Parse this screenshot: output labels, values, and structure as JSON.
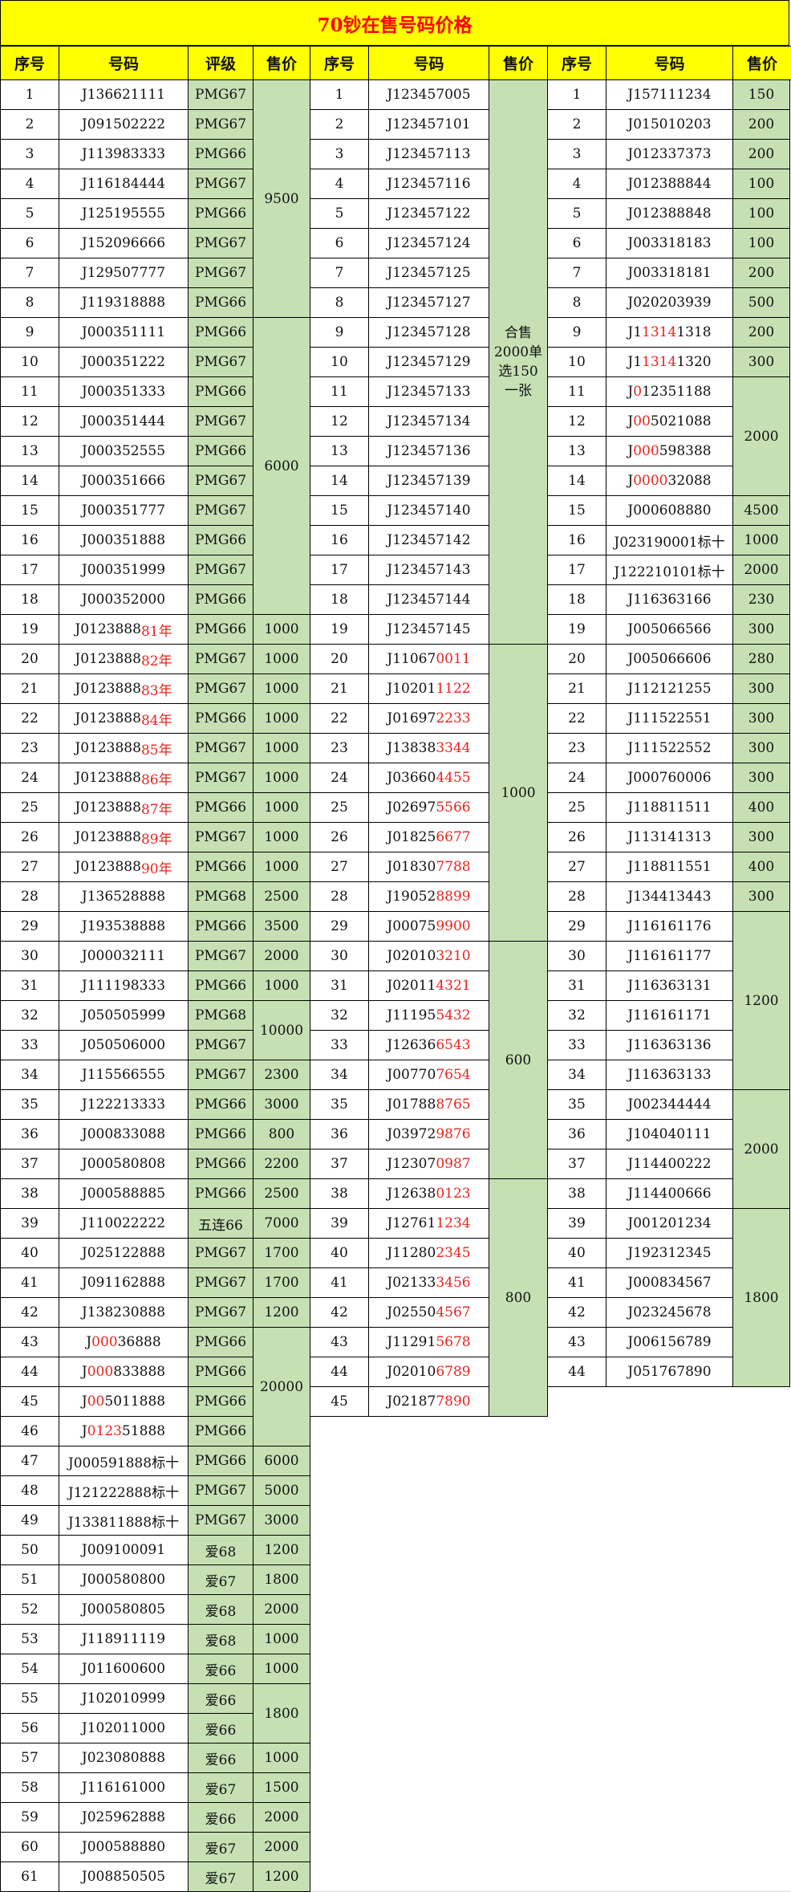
{
  "title": "70钞在售号码价格",
  "colors": {
    "header_bg": "#ffff00",
    "title_text": "#ff0000",
    "green": "#c6e0b4",
    "highlight": "#e8241d"
  },
  "headers": {
    "left": [
      "序号",
      "号码",
      "评级",
      "售价"
    ],
    "middle": [
      "序号",
      "号码",
      "售价"
    ],
    "right": [
      "序号",
      "号码",
      "售价"
    ]
  },
  "left_rows": [
    {
      "n": "1",
      "c": "J136621111",
      "g": "PMG67"
    },
    {
      "n": "2",
      "c": "J091502222",
      "g": "PMG67"
    },
    {
      "n": "3",
      "c": "J113983333",
      "g": "PMG66"
    },
    {
      "n": "4",
      "c": "J116184444",
      "g": "PMG67"
    },
    {
      "n": "5",
      "c": "J125195555",
      "g": "PMG66"
    },
    {
      "n": "6",
      "c": "J152096666",
      "g": "PMG67"
    },
    {
      "n": "7",
      "c": "J129507777",
      "g": "PMG67"
    },
    {
      "n": "8",
      "c": "J119318888",
      "g": "PMG66"
    },
    {
      "n": "9",
      "c": "J000351111",
      "g": "PMG66"
    },
    {
      "n": "10",
      "c": "J000351222",
      "g": "PMG67"
    },
    {
      "n": "11",
      "c": "J000351333",
      "g": "PMG66"
    },
    {
      "n": "12",
      "c": "J000351444",
      "g": "PMG67"
    },
    {
      "n": "13",
      "c": "J000352555",
      "g": "PMG66"
    },
    {
      "n": "14",
      "c": "J000351666",
      "g": "PMG67"
    },
    {
      "n": "15",
      "c": "J000351777",
      "g": "PMG67"
    },
    {
      "n": "16",
      "c": "J000351888",
      "g": "PMG66"
    },
    {
      "n": "17",
      "c": "J000351999",
      "g": "PMG67"
    },
    {
      "n": "18",
      "c": "J000352000",
      "g": "PMG66"
    },
    {
      "n": "19",
      "c": "J0123888",
      "r": "81年",
      "g": "PMG66"
    },
    {
      "n": "20",
      "c": "J0123888",
      "r": "82年",
      "g": "PMG67"
    },
    {
      "n": "21",
      "c": "J0123888",
      "r": "83年",
      "g": "PMG67"
    },
    {
      "n": "22",
      "c": "J0123888",
      "r": "84年",
      "g": "PMG66"
    },
    {
      "n": "23",
      "c": "J0123888",
      "r": "85年",
      "g": "PMG67"
    },
    {
      "n": "24",
      "c": "J0123888",
      "r": "86年",
      "g": "PMG67"
    },
    {
      "n": "25",
      "c": "J0123888",
      "r": "87年",
      "g": "PMG66"
    },
    {
      "n": "26",
      "c": "J0123888",
      "r": "89年",
      "g": "PMG67"
    },
    {
      "n": "27",
      "c": "J0123888",
      "r": "90年",
      "g": "PMG66"
    },
    {
      "n": "28",
      "c": "J136528888",
      "g": "PMG68"
    },
    {
      "n": "29",
      "c": "J193538888",
      "g": "PMG66"
    },
    {
      "n": "30",
      "c": "J000032111",
      "g": "PMG67"
    },
    {
      "n": "31",
      "c": "J111198333",
      "g": "PMG66"
    },
    {
      "n": "32",
      "c": "J050505999",
      "g": "PMG68"
    },
    {
      "n": "33",
      "c": "J050506000",
      "g": "PMG67"
    },
    {
      "n": "34",
      "c": "J115566555",
      "g": "PMG67"
    },
    {
      "n": "35",
      "c": "J122213333",
      "g": "PMG66"
    },
    {
      "n": "36",
      "c": "J000833088",
      "g": "PMG66"
    },
    {
      "n": "37",
      "c": "J000580808",
      "g": "PMG66"
    },
    {
      "n": "38",
      "c": "J000588885",
      "g": "PMG66"
    },
    {
      "n": "39",
      "c": "J110022222",
      "g": "五连66"
    },
    {
      "n": "40",
      "c": "J025122888",
      "g": "PMG67"
    },
    {
      "n": "41",
      "c": "J091162888",
      "g": "PMG67"
    },
    {
      "n": "42",
      "c": "J138230888",
      "g": "PMG67"
    },
    {
      "n": "43",
      "c": "J",
      "r": "000",
      "c2": "36888",
      "g": "PMG66"
    },
    {
      "n": "44",
      "c": "J",
      "r": "000",
      "c2": "833888",
      "g": "PMG66"
    },
    {
      "n": "45",
      "c": "J",
      "r": "00",
      "c2": "5011888",
      "g": "PMG66"
    },
    {
      "n": "46",
      "c": "J",
      "r": "0123",
      "c2": "51888",
      "g": "PMG66"
    },
    {
      "n": "47",
      "c": "J000591888标十",
      "g": "PMG66"
    },
    {
      "n": "48",
      "c": "J121222888标十",
      "g": "PMG67"
    },
    {
      "n": "49",
      "c": "J133811888标十",
      "g": "PMG67"
    },
    {
      "n": "50",
      "c": "J009100091",
      "g": "爱68"
    },
    {
      "n": "51",
      "c": "J000580800",
      "g": "爱67"
    },
    {
      "n": "52",
      "c": "J000580805",
      "g": "爱68"
    },
    {
      "n": "53",
      "c": "J118911119",
      "g": "爱68"
    },
    {
      "n": "54",
      "c": "J011600600",
      "g": "爱66"
    },
    {
      "n": "55",
      "c": "J102010999",
      "g": "爱66"
    },
    {
      "n": "56",
      "c": "J102011000",
      "g": "爱66"
    },
    {
      "n": "57",
      "c": "J023080888",
      "g": "爱66"
    },
    {
      "n": "58",
      "c": "J116161000",
      "g": "爱67"
    },
    {
      "n": "59",
      "c": "J025962888",
      "g": "爱66"
    },
    {
      "n": "60",
      "c": "J000588880",
      "g": "爱67"
    },
    {
      "n": "61",
      "c": "J008850505",
      "g": "爱67"
    }
  ],
  "left_prices": [
    {
      "start": 0,
      "span": 8,
      "v": "9500"
    },
    {
      "start": 8,
      "span": 10,
      "v": "6000"
    },
    {
      "start": 18,
      "span": 1,
      "v": "1000"
    },
    {
      "start": 19,
      "span": 1,
      "v": "1000"
    },
    {
      "start": 20,
      "span": 1,
      "v": "1000"
    },
    {
      "start": 21,
      "span": 1,
      "v": "1000"
    },
    {
      "start": 22,
      "span": 1,
      "v": "1000"
    },
    {
      "start": 23,
      "span": 1,
      "v": "1000"
    },
    {
      "start": 24,
      "span": 1,
      "v": "1000"
    },
    {
      "start": 25,
      "span": 1,
      "v": "1000"
    },
    {
      "start": 26,
      "span": 1,
      "v": "1000"
    },
    {
      "start": 27,
      "span": 1,
      "v": "2500"
    },
    {
      "start": 28,
      "span": 1,
      "v": "3500"
    },
    {
      "start": 29,
      "span": 1,
      "v": "2000"
    },
    {
      "start": 30,
      "span": 1,
      "v": "1000"
    },
    {
      "start": 31,
      "span": 2,
      "v": "10000"
    },
    {
      "start": 33,
      "span": 1,
      "v": "2300"
    },
    {
      "start": 34,
      "span": 1,
      "v": "3000"
    },
    {
      "start": 35,
      "span": 1,
      "v": "800"
    },
    {
      "start": 36,
      "span": 1,
      "v": "2200"
    },
    {
      "start": 37,
      "span": 1,
      "v": "2500"
    },
    {
      "start": 38,
      "span": 1,
      "v": "7000"
    },
    {
      "start": 39,
      "span": 1,
      "v": "1700"
    },
    {
      "start": 40,
      "span": 1,
      "v": "1700"
    },
    {
      "start": 41,
      "span": 1,
      "v": "1200"
    },
    {
      "start": 42,
      "span": 4,
      "v": "20000"
    },
    {
      "start": 46,
      "span": 1,
      "v": "6000"
    },
    {
      "start": 47,
      "span": 1,
      "v": "5000"
    },
    {
      "start": 48,
      "span": 1,
      "v": "3000"
    },
    {
      "start": 49,
      "span": 1,
      "v": "1200"
    },
    {
      "start": 50,
      "span": 1,
      "v": "1800"
    },
    {
      "start": 51,
      "span": 1,
      "v": "2000"
    },
    {
      "start": 52,
      "span": 1,
      "v": "1000"
    },
    {
      "start": 53,
      "span": 1,
      "v": "1000"
    },
    {
      "start": 54,
      "span": 2,
      "v": "1800"
    },
    {
      "start": 56,
      "span": 1,
      "v": "1000"
    },
    {
      "start": 57,
      "span": 1,
      "v": "1500"
    },
    {
      "start": 58,
      "span": 1,
      "v": "2000"
    },
    {
      "start": 59,
      "span": 1,
      "v": "2000"
    },
    {
      "start": 60,
      "span": 1,
      "v": "1200"
    }
  ],
  "middle_rows": [
    {
      "n": "1",
      "c": "J123457005"
    },
    {
      "n": "2",
      "c": "J123457101"
    },
    {
      "n": "3",
      "c": "J123457113"
    },
    {
      "n": "4",
      "c": "J123457116"
    },
    {
      "n": "5",
      "c": "J123457122"
    },
    {
      "n": "6",
      "c": "J123457124"
    },
    {
      "n": "7",
      "c": "J123457125"
    },
    {
      "n": "8",
      "c": "J123457127"
    },
    {
      "n": "9",
      "c": "J123457128"
    },
    {
      "n": "10",
      "c": "J123457129"
    },
    {
      "n": "11",
      "c": "J123457133"
    },
    {
      "n": "12",
      "c": "J123457134"
    },
    {
      "n": "13",
      "c": "J123457136"
    },
    {
      "n": "14",
      "c": "J123457139"
    },
    {
      "n": "15",
      "c": "J123457140"
    },
    {
      "n": "16",
      "c": "J123457142"
    },
    {
      "n": "17",
      "c": "J123457143"
    },
    {
      "n": "18",
      "c": "J123457144"
    },
    {
      "n": "19",
      "c": "J123457145"
    },
    {
      "n": "20",
      "c": "J11067",
      "r": "0011"
    },
    {
      "n": "21",
      "c": "J10201",
      "r": "1122"
    },
    {
      "n": "22",
      "c": "J01697",
      "r": "2233"
    },
    {
      "n": "23",
      "c": "J13838",
      "r": "3344"
    },
    {
      "n": "24",
      "c": "J03660",
      "r": "4455"
    },
    {
      "n": "25",
      "c": "J02697",
      "r": "5566"
    },
    {
      "n": "26",
      "c": "J01825",
      "r": "6677"
    },
    {
      "n": "27",
      "c": "J01830",
      "r": "7788"
    },
    {
      "n": "28",
      "c": "J19052",
      "r": "8899"
    },
    {
      "n": "29",
      "c": "J00075",
      "r": "9900"
    },
    {
      "n": "30",
      "c": "J02010",
      "r": "3210"
    },
    {
      "n": "31",
      "c": "J02011",
      "r": "4321"
    },
    {
      "n": "32",
      "c": "J11195",
      "r": "5432"
    },
    {
      "n": "33",
      "c": "J12636",
      "r": "6543"
    },
    {
      "n": "34",
      "c": "J00770",
      "r": "7654"
    },
    {
      "n": "35",
      "c": "J01788",
      "r": "8765"
    },
    {
      "n": "36",
      "c": "J03972",
      "r": "9876"
    },
    {
      "n": "37",
      "c": "J12307",
      "r": "0987"
    },
    {
      "n": "38",
      "c": "J12638",
      "r": "0123"
    },
    {
      "n": "39",
      "c": "J12761",
      "r": "1234"
    },
    {
      "n": "40",
      "c": "J11280",
      "r": "2345"
    },
    {
      "n": "41",
      "c": "J02133",
      "r": "3456"
    },
    {
      "n": "42",
      "c": "J02550",
      "r": "4567"
    },
    {
      "n": "43",
      "c": "J11291",
      "r": "5678"
    },
    {
      "n": "44",
      "c": "J02010",
      "r": "6789"
    },
    {
      "n": "45",
      "c": "J02187",
      "r": "7890"
    }
  ],
  "middle_prices": [
    {
      "start": 0,
      "span": 19,
      "v": "合售\n2000单\n选150\n一张"
    },
    {
      "start": 19,
      "span": 10,
      "v": "1000"
    },
    {
      "start": 29,
      "span": 8,
      "v": "600"
    },
    {
      "start": 37,
      "span": 8,
      "v": "800"
    }
  ],
  "right_rows": [
    {
      "n": "1",
      "c": "J157111234"
    },
    {
      "n": "2",
      "c": "J015010203"
    },
    {
      "n": "3",
      "c": "J012337373"
    },
    {
      "n": "4",
      "c": "J012388844"
    },
    {
      "n": "5",
      "c": "J012388848"
    },
    {
      "n": "6",
      "c": "J003318183"
    },
    {
      "n": "7",
      "c": "J003318181"
    },
    {
      "n": "8",
      "c": "J020203939"
    },
    {
      "n": "9",
      "c": "J1",
      "r": "1314",
      "c2": "1318"
    },
    {
      "n": "10",
      "c": "J1",
      "r": "1314",
      "c2": "1320"
    },
    {
      "n": "11",
      "c": "J",
      "r": "0",
      "c2": "12351188"
    },
    {
      "n": "12",
      "c": "J",
      "r": "00",
      "c2": "5021088"
    },
    {
      "n": "13",
      "c": "J",
      "r": "000",
      "c2": "598388"
    },
    {
      "n": "14",
      "c": "J",
      "r": "0000",
      "c2": "32088"
    },
    {
      "n": "15",
      "c": "J000608880"
    },
    {
      "n": "16",
      "c": "J023190001标十"
    },
    {
      "n": "17",
      "c": "J122210101标十"
    },
    {
      "n": "18",
      "c": "J116363166"
    },
    {
      "n": "19",
      "c": "J005066566"
    },
    {
      "n": "20",
      "c": "J005066606"
    },
    {
      "n": "21",
      "c": "J112121255"
    },
    {
      "n": "22",
      "c": "J111522551"
    },
    {
      "n": "23",
      "c": "J111522552"
    },
    {
      "n": "24",
      "c": "J000760006"
    },
    {
      "n": "25",
      "c": "J118811511"
    },
    {
      "n": "26",
      "c": "J113141313"
    },
    {
      "n": "27",
      "c": "J118811551"
    },
    {
      "n": "28",
      "c": "J134413443"
    },
    {
      "n": "29",
      "c": "J116161176"
    },
    {
      "n": "30",
      "c": "J116161177"
    },
    {
      "n": "31",
      "c": "J116363131"
    },
    {
      "n": "32",
      "c": "J116161171"
    },
    {
      "n": "33",
      "c": "J116363136"
    },
    {
      "n": "34",
      "c": "J116363133"
    },
    {
      "n": "35",
      "c": "J002344444"
    },
    {
      "n": "36",
      "c": "J104040111"
    },
    {
      "n": "37",
      "c": "J114400222"
    },
    {
      "n": "38",
      "c": "J114400666"
    },
    {
      "n": "39",
      "c": "J001201234"
    },
    {
      "n": "40",
      "c": "J192312345"
    },
    {
      "n": "41",
      "c": "J000834567"
    },
    {
      "n": "42",
      "c": "J023245678"
    },
    {
      "n": "43",
      "c": "J006156789"
    },
    {
      "n": "44",
      "c": "J051767890"
    }
  ],
  "right_prices": [
    {
      "start": 0,
      "span": 1,
      "v": "150"
    },
    {
      "start": 1,
      "span": 1,
      "v": "200"
    },
    {
      "start": 2,
      "span": 1,
      "v": "200"
    },
    {
      "start": 3,
      "span": 1,
      "v": "100"
    },
    {
      "start": 4,
      "span": 1,
      "v": "100"
    },
    {
      "start": 5,
      "span": 1,
      "v": "100"
    },
    {
      "start": 6,
      "span": 1,
      "v": "200"
    },
    {
      "start": 7,
      "span": 1,
      "v": "500"
    },
    {
      "start": 8,
      "span": 1,
      "v": "200"
    },
    {
      "start": 9,
      "span": 1,
      "v": "300"
    },
    {
      "start": 10,
      "span": 4,
      "v": "2000"
    },
    {
      "start": 14,
      "span": 1,
      "v": "4500"
    },
    {
      "start": 15,
      "span": 1,
      "v": "1000"
    },
    {
      "start": 16,
      "span": 1,
      "v": "2000"
    },
    {
      "start": 17,
      "span": 1,
      "v": "230"
    },
    {
      "start": 18,
      "span": 1,
      "v": "300"
    },
    {
      "start": 19,
      "span": 1,
      "v": "280"
    },
    {
      "start": 20,
      "span": 1,
      "v": "300"
    },
    {
      "start": 21,
      "span": 1,
      "v": "300"
    },
    {
      "start": 22,
      "span": 1,
      "v": "300"
    },
    {
      "start": 23,
      "span": 1,
      "v": "300"
    },
    {
      "start": 24,
      "span": 1,
      "v": "400"
    },
    {
      "start": 25,
      "span": 1,
      "v": "300"
    },
    {
      "start": 26,
      "span": 1,
      "v": "400"
    },
    {
      "start": 27,
      "span": 1,
      "v": "300"
    },
    {
      "start": 28,
      "span": 6,
      "v": "1200"
    },
    {
      "start": 34,
      "span": 4,
      "v": "2000"
    },
    {
      "start": 38,
      "span": 6,
      "v": "1800"
    }
  ]
}
